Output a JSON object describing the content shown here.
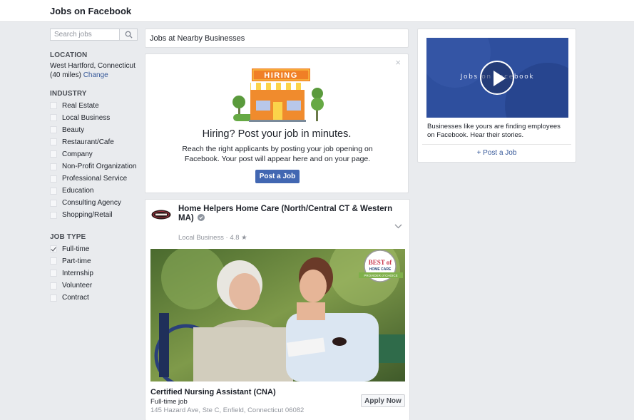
{
  "header": {
    "title": "Jobs on Facebook"
  },
  "sidebar": {
    "search_placeholder": "Search jobs",
    "location_heading": "LOCATION",
    "location_line1": "West Hartford, Connecticut",
    "location_line2": "(40 miles)",
    "location_change": "Change",
    "industry_heading": "INDUSTRY",
    "industries": [
      "Real Estate",
      "Local Business",
      "Beauty",
      "Restaurant/Cafe",
      "Company",
      "Non-Profit Organization",
      "Professional Service",
      "Education",
      "Consulting Agency",
      "Shopping/Retail"
    ],
    "jobtype_heading": "JOB TYPE",
    "job_types": [
      {
        "label": "Full-time",
        "checked": true
      },
      {
        "label": "Part-time",
        "checked": false
      },
      {
        "label": "Internship",
        "checked": false
      },
      {
        "label": "Volunteer",
        "checked": false
      },
      {
        "label": "Contract",
        "checked": false
      }
    ]
  },
  "main": {
    "nearby_title": "Jobs at Nearby Businesses",
    "hiring": {
      "sign": "HIRING",
      "close": "×",
      "headline": "Hiring? Post your job in minutes.",
      "body": "Reach the right applicants by posting your job opening on Facebook. Your post will appear here and on your page.",
      "button": "Post a Job"
    },
    "job": {
      "business": "Home Helpers Home Care (North/Central CT & Western MA)",
      "category": "Local Business · 4.8 ★",
      "badge_line1": "BEST of",
      "badge_line2": "HOME CARE",
      "badge_line3": "PROVIDER of CHOICE",
      "title": "Certified Nursing Assistant (CNA)",
      "type": "Full-time job",
      "address": "145 Hazard Ave, Ste C, Enfield, Connecticut 06082",
      "apply": "Apply Now"
    }
  },
  "right": {
    "video_text": "Jobs on Facebook",
    "description": "Businesses like yours are finding employees on Facebook. Hear their stories.",
    "post_link": "+ Post a Job"
  },
  "colors": {
    "accent": "#4267b2",
    "link": "#365899",
    "background": "#e9ebee",
    "hiring_sign": "#f07f26"
  }
}
